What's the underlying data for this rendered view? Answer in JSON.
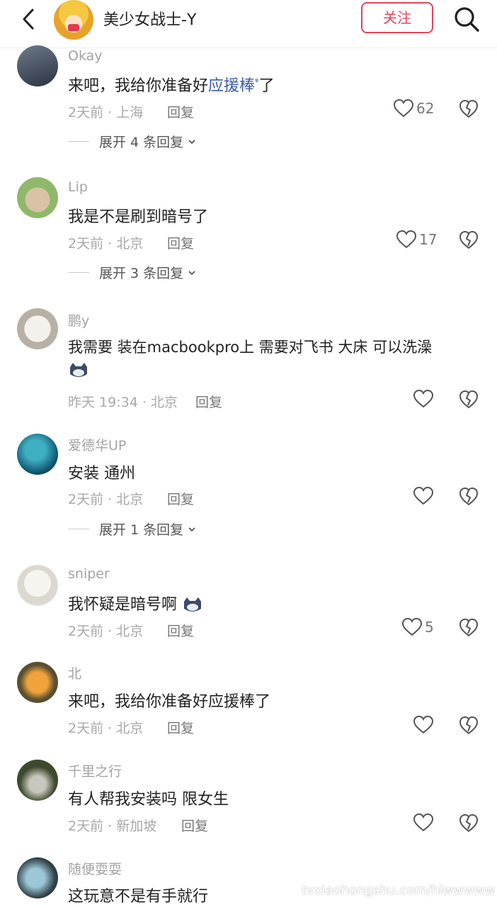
{
  "header": {
    "back_icon": "chevron-left-icon",
    "account_name": "美少女战士-Y",
    "follow_label": "关注",
    "search_icon": "search-icon",
    "follow_color": "#e2455a"
  },
  "comments": [
    {
      "user": "Okay",
      "text_before": "来吧，我给你准备好",
      "text_link": "应援棒",
      "text_after": "了",
      "time_location": "2天前 · 上海",
      "reply_label": "回复",
      "likes": "62",
      "expand": "展开 4 条回复"
    },
    {
      "user": "Lip",
      "text": "我是不是刷到暗号了",
      "time_location": "2天前 · 北京",
      "reply_label": "回复",
      "likes": "17",
      "expand": "展开 3 条回复"
    },
    {
      "user": "鹏y",
      "text": "我需要 装在macbookpro上 需要对飞书 大床 可以洗澡",
      "time_location": "昨天 19:34 · 北京",
      "reply_label": "回复",
      "likes": ""
    },
    {
      "user": "爱德华UP",
      "text": "安装 通州",
      "time_location": "2天前 · 北京",
      "reply_label": "回复",
      "likes": "",
      "expand": "展开 1 条回复"
    },
    {
      "user": "sniper",
      "text": "我怀疑是暗号啊",
      "time_location": "2天前 · 北京",
      "reply_label": "回复",
      "likes": "5"
    },
    {
      "user": "北",
      "text": "来吧，我给你准备好应援棒了",
      "time_location": "2天前 · 北京",
      "reply_label": "回复",
      "likes": ""
    },
    {
      "user": "千里之行",
      "text": "有人帮我安装吗 限女生",
      "time_location": "2天前 · 新加坡",
      "reply_label": "回复",
      "likes": ""
    },
    {
      "user": "随便耍耍",
      "text": "这玩意不是有手就行",
      "time_location": "",
      "reply_label": "",
      "likes": ""
    }
  ],
  "watermark": "tvxiaohongshu.com/hlwwwww"
}
